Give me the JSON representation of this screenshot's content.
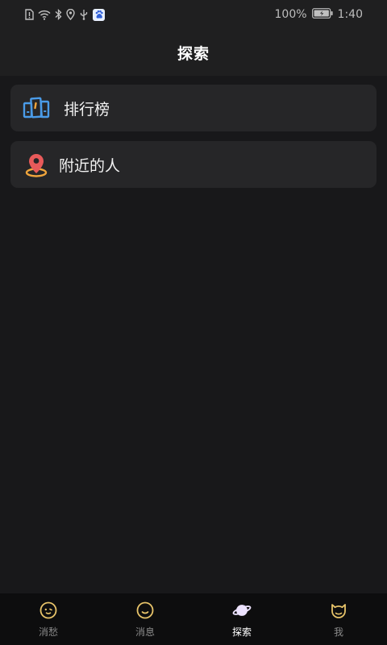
{
  "status_bar": {
    "battery": "100%",
    "time": "1:40",
    "icons": [
      "alert-icon",
      "wifi-icon",
      "bluetooth-icon",
      "location-icon",
      "usb-icon",
      "baidu-icon",
      "battery-icon"
    ]
  },
  "header": {
    "title": "探索"
  },
  "menu": {
    "items": [
      {
        "label": "排行榜",
        "icon": "ranking-icon"
      },
      {
        "label": "附近的人",
        "icon": "location-pin-icon"
      }
    ]
  },
  "bottom_nav": {
    "items": [
      {
        "label": "消愁",
        "icon": "face-icon",
        "active": false
      },
      {
        "label": "消息",
        "icon": "message-face-icon",
        "active": false
      },
      {
        "label": "探索",
        "icon": "planet-icon",
        "active": true
      },
      {
        "label": "我",
        "icon": "cat-face-icon",
        "active": false
      }
    ]
  },
  "colors": {
    "background": "#18181a",
    "header": "#1f1f20",
    "card": "#262628",
    "nav_bar": "#0d0d0e",
    "accent_blue": "#4a9be8",
    "accent_orange": "#f0a53c",
    "accent_red": "#e85a5a",
    "icon_yellow": "#e8c46a"
  }
}
